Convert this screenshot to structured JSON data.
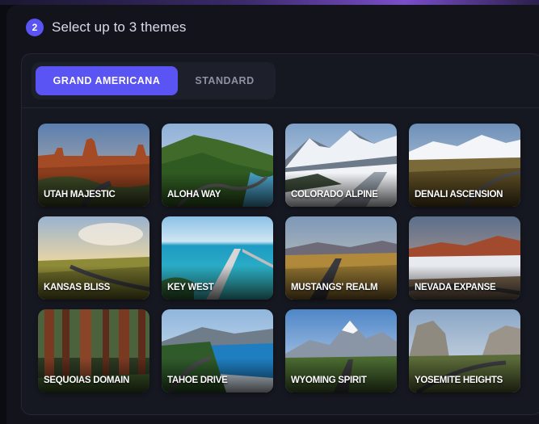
{
  "step": {
    "number": "2",
    "title": "Select up to 3 themes"
  },
  "tabs": [
    {
      "label": "GRAND AMERICANA",
      "active": true
    },
    {
      "label": "STANDARD",
      "active": false
    }
  ],
  "themes": [
    {
      "label": "UTAH MAJESTIC"
    },
    {
      "label": "ALOHA WAY"
    },
    {
      "label": "COLORADO ALPINE"
    },
    {
      "label": "DENALI ASCENSION"
    },
    {
      "label": "KANSAS BLISS"
    },
    {
      "label": "KEY WEST"
    },
    {
      "label": "MUSTANGS' REALM"
    },
    {
      "label": "NEVADA EXPANSE"
    },
    {
      "label": "SEQUOIAS DOMAIN"
    },
    {
      "label": "TAHOE DRIVE"
    },
    {
      "label": "WYOMING SPIRIT"
    },
    {
      "label": "YOSEMITE HEIGHTS"
    }
  ],
  "colors": {
    "accent": "#5b54f5",
    "background": "#0b0c12",
    "panel": "#161821"
  }
}
